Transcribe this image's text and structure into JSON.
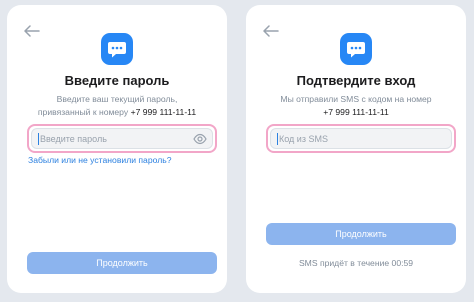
{
  "colors": {
    "accent": "#2d81e0",
    "button_bg": "#8cb4ee",
    "highlight": "#e8669e",
    "background": "#e4e8ee"
  },
  "password_screen": {
    "back_icon": "arrow-left-icon",
    "logo_icon": "chat-bubble-icon",
    "title": "Введите пароль",
    "description_line1": "Введите ваш текущий пароль,",
    "description_line2": "привязанный к номеру",
    "phone": "+7 999 111-11-11",
    "input": {
      "placeholder": "Введите пароль",
      "value": ""
    },
    "eye_icon": "eye-icon",
    "forgot_link": "Забыли или не установили пароль?",
    "continue_label": "Продолжить"
  },
  "sms_screen": {
    "back_icon": "arrow-left-icon",
    "logo_icon": "chat-bubble-icon",
    "title": "Подтвердите вход",
    "description_line1": "Мы отправили SMS с кодом на номер",
    "phone": "+7 999 111-11-11",
    "input": {
      "placeholder": "Код из SMS",
      "value": ""
    },
    "continue_label": "Продолжить",
    "timer_text": "SMS придёт в течение 00:59"
  }
}
